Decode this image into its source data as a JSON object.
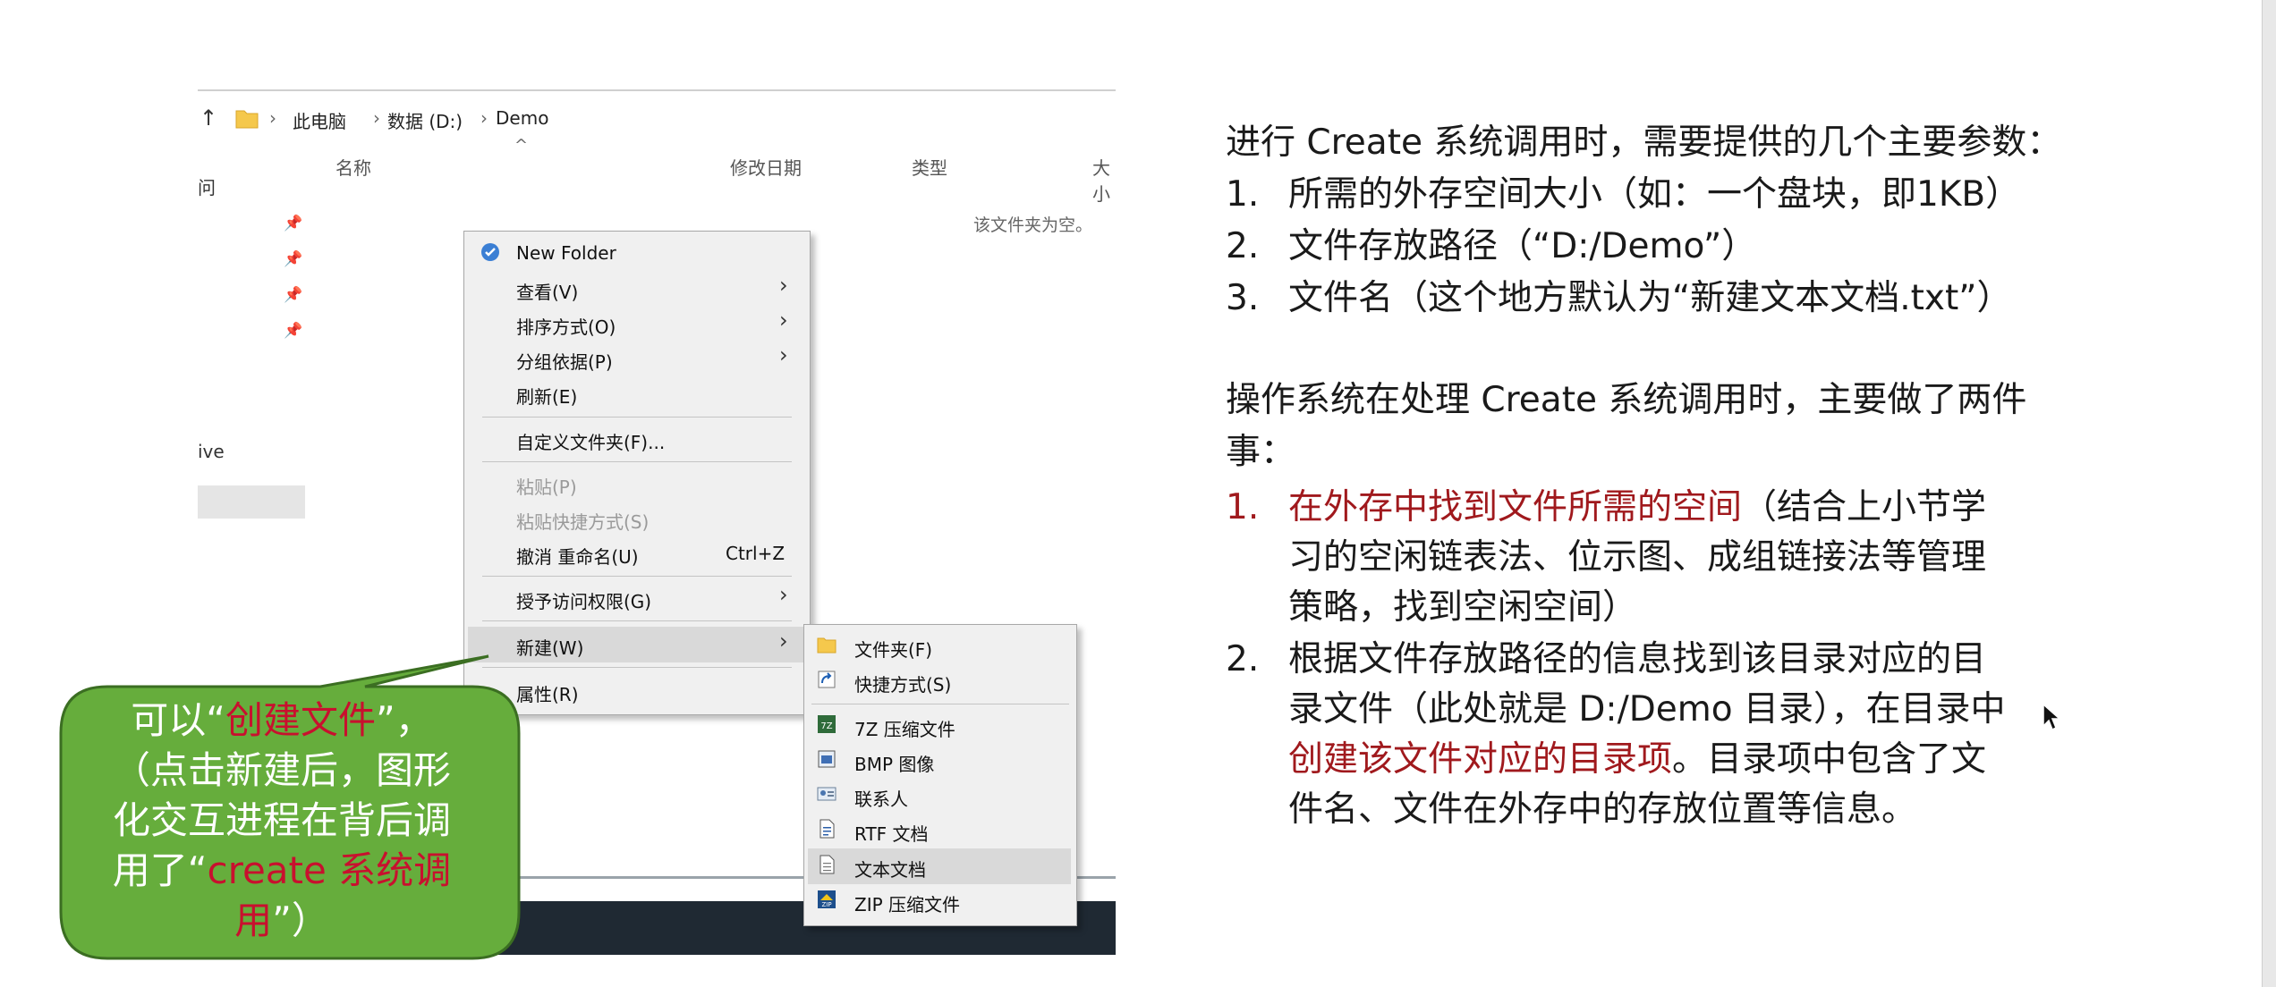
{
  "explorer": {
    "breadcrumb": [
      "此电脑",
      "数据 (D:)",
      "Demo"
    ],
    "columns": {
      "name": "名称",
      "modified": "修改日期",
      "type": "类型",
      "size": "大小"
    },
    "empty_text": "该文件夹为空。",
    "sidebar_fragment_top": "问",
    "sidebar_fragment_mid": "ive"
  },
  "context_menu": {
    "new_folder": "New Folder",
    "view": "查看(V)",
    "sort": "排序方式(O)",
    "group": "分组依据(P)",
    "refresh": "刷新(E)",
    "customize": "自定义文件夹(F)...",
    "paste": "粘贴(P)",
    "paste_shortcut": "粘贴快捷方式(S)",
    "undo": "撤消 重命名(U)",
    "undo_shortcut": "Ctrl+Z",
    "grant_access": "授予访问权限(G)",
    "new": "新建(W)",
    "properties": "属性(R)"
  },
  "new_submenu": {
    "folder": "文件夹(F)",
    "shortcut": "快捷方式(S)",
    "zip7": "7Z 压缩文件",
    "bmp": "BMP 图像",
    "contact": "联系人",
    "rtf": "RTF 文档",
    "text": "文本文档",
    "zip": "ZIP 压缩文件"
  },
  "callout": {
    "line1_a": "可以“",
    "line1_b": "创建文件",
    "line1_c": "”，",
    "line2": "（点击新建后，图形",
    "line3": "化交互进程在背后调",
    "line4_a": "用了“",
    "line4_b": "create 系统调",
    "line5_a": "用",
    "line5_b": "”）"
  },
  "notes": {
    "intro": "进行 Create 系统调用时，需要提供的几个主要参数：",
    "params": [
      {
        "num": "1.",
        "text": "所需的外存空间大小（如：一个盘块，即1KB）"
      },
      {
        "num": "2.",
        "text": "文件存放路径（“D:/Demo”）"
      },
      {
        "num": "3.",
        "text": "文件名（这个地方默认为“新建文本文档.txt”）"
      }
    ],
    "os_line1": "操作系统在处理 Create 系统调用时，主要做了两件",
    "os_line2": "事：",
    "step1_num": "1.",
    "step1_red": "在外存中找到文件所需的空间",
    "step1_a": "（结合上小节学",
    "step1_b": "习的空闲链表法、位示图、成组链接法等管理",
    "step1_c": "策略，找到空闲空间）",
    "step2_num": "2.",
    "step2_a": "根据文件存放路径的信息找到该目录对应的目",
    "step2_b": "录文件（此处就是 D:/Demo 目录），在目录中",
    "step2_red": "创建该文件对应的目录项",
    "step2_c": "。目录项中包含了文",
    "step2_d": "件名、文件在外存中的存放位置等信息。"
  },
  "colors": {
    "callout_fill": "#66ad3c",
    "accent_red": "#a0191d",
    "menu_bg": "#f0f0f0"
  }
}
